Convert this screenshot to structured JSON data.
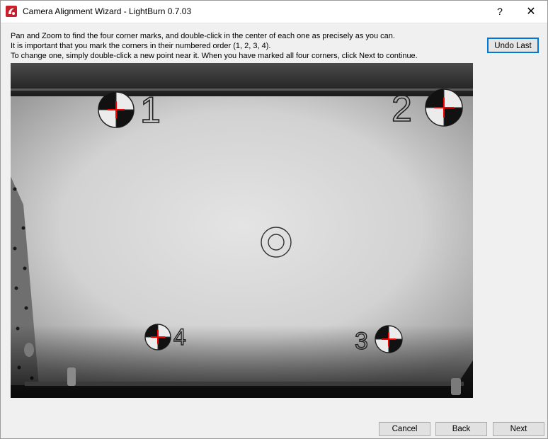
{
  "window": {
    "title": "Camera Alignment Wizard - LightBurn 0.7.03",
    "help_label": "?",
    "close_label": "✕",
    "icon": "lightburn-app-icon"
  },
  "instructions": {
    "line1": "Pan and Zoom to find the four corner marks, and double-click in the center of each one as precisely as you can.",
    "line2": "It is important that you mark the corners in their numbered order (1, 2, 3, 4).",
    "line3": "To change one, simply double-click a new point near it.  When you have marked all four corners, click Next to continue."
  },
  "buttons": {
    "undo_last": "Undo Last",
    "cancel": "Cancel",
    "back": "Back",
    "next": "Next"
  },
  "camera_view": {
    "markers": [
      {
        "label": "1"
      },
      {
        "label": "2"
      },
      {
        "label": "3"
      },
      {
        "label": "4"
      }
    ],
    "crosshair_color": "#ff0000"
  }
}
